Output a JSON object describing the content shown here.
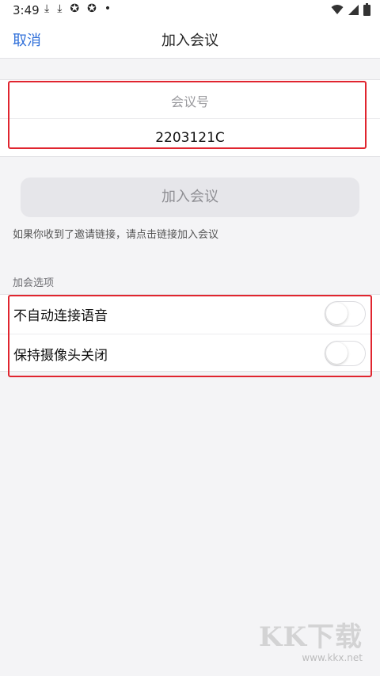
{
  "status_bar": {
    "time": "3:49",
    "notification_icons": [
      "download-icon",
      "download-icon",
      "app-icon",
      "app-icon",
      "dot-icon"
    ],
    "right_icons": [
      "wifi-icon",
      "signal-icon",
      "battery-icon"
    ]
  },
  "nav": {
    "cancel_label": "取消",
    "title": "加入会议"
  },
  "meeting_id": {
    "label": "会议号",
    "value": "2203121C"
  },
  "join_button_label": "加入会议",
  "hint_text": "如果你收到了邀请链接，请点击链接加入会议",
  "options": {
    "section_title": "加会选项",
    "items": [
      {
        "label": "不自动连接语音",
        "enabled": false
      },
      {
        "label": "保持摄像头关闭",
        "enabled": false
      }
    ]
  },
  "watermark": {
    "logo": "KK下载",
    "url": "www.kkx.net"
  },
  "colors": {
    "accent": "#2f6fd9",
    "highlight_box": "#e0252f",
    "background": "#f4f4f6"
  }
}
